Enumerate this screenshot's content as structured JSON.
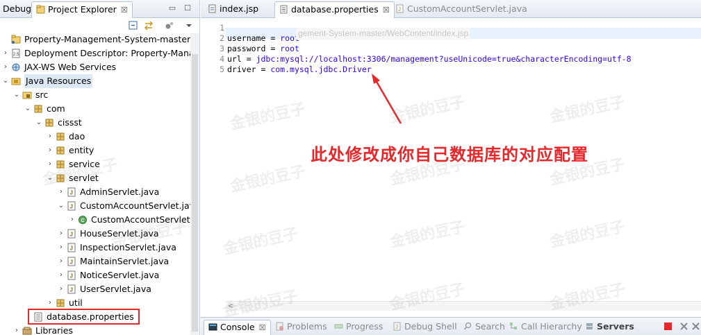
{
  "left_panel": {
    "tabs": [
      {
        "label": "Debug"
      },
      {
        "label": "Project Explorer",
        "close": "☒"
      }
    ]
  },
  "tree": {
    "items": [
      {
        "label": "Property-Management-System-master",
        "icon": "project-icon"
      },
      {
        "label": "Deployment Descriptor: Property-Manag",
        "icon": "deployment-descriptor-icon"
      },
      {
        "label": "JAX-WS Web Services",
        "icon": "web-services-icon"
      },
      {
        "label": "Java Resources",
        "icon": "java-resources-icon"
      },
      {
        "label": "src",
        "icon": "source-folder-icon"
      },
      {
        "label": "com",
        "icon": "package-icon"
      },
      {
        "label": "cissst",
        "icon": "package-icon"
      },
      {
        "label": "dao",
        "icon": "package-icon"
      },
      {
        "label": "entity",
        "icon": "package-icon"
      },
      {
        "label": "service",
        "icon": "package-icon"
      },
      {
        "label": "servlet",
        "icon": "package-icon"
      },
      {
        "label": "AdminServlet.java",
        "icon": "java-file-icon"
      },
      {
        "label": "CustomAccountServlet.java",
        "icon": "java-file-icon"
      },
      {
        "label": "CustomAccountServlet",
        "icon": "java-class-icon"
      },
      {
        "label": "HouseServlet.java",
        "icon": "java-file-icon"
      },
      {
        "label": "InspectionServlet.java",
        "icon": "java-file-icon"
      },
      {
        "label": "MaintainServlet.java",
        "icon": "java-file-icon"
      },
      {
        "label": "NoticeServlet.java",
        "icon": "java-file-icon"
      },
      {
        "label": "UserServlet.java",
        "icon": "java-file-icon"
      },
      {
        "label": "util",
        "icon": "package-icon"
      },
      {
        "label": "database.properties",
        "icon": "properties-file-icon"
      },
      {
        "label": "Libraries",
        "icon": "libraries-icon"
      }
    ]
  },
  "editor": {
    "tabs": [
      {
        "label": "index.jsp"
      },
      {
        "label": "database.properties",
        "close": "☒"
      },
      {
        "label": "CustomAccountServlet.java"
      }
    ],
    "hover_path": "gement-System-master/WebContent/index.jsp",
    "lines": [
      {
        "num": "1",
        "key": "",
        "eq": "",
        "val": ""
      },
      {
        "num": "2",
        "key": "username",
        "eq": " = ",
        "val": "root"
      },
      {
        "num": "3",
        "key": "password",
        "eq": " = ",
        "val": "root"
      },
      {
        "num": "4",
        "key": "url",
        "eq": " = ",
        "val": "jdbc:mysql://localhost:3306/management?useUnicode=true&characterEncoding=utf-8"
      },
      {
        "num": "5",
        "key": "driver",
        "eq": " = ",
        "val": "com.mysql.jdbc.Driver"
      }
    ],
    "scroll_left": "<",
    "annotation": "此处修改成你自己数据库的对应配置"
  },
  "watermark": "金银的豆子",
  "bottom": {
    "tabs": [
      {
        "label": "Console",
        "close": "☒"
      },
      {
        "label": "Problems"
      },
      {
        "label": "Progress"
      },
      {
        "label": "Debug Shell"
      },
      {
        "label": "Search"
      },
      {
        "label": "Call Hierarchy"
      },
      {
        "label": "Servers"
      }
    ]
  },
  "colors": {
    "accent_red": "#e8272b",
    "value_blue": "#2a00ff"
  }
}
